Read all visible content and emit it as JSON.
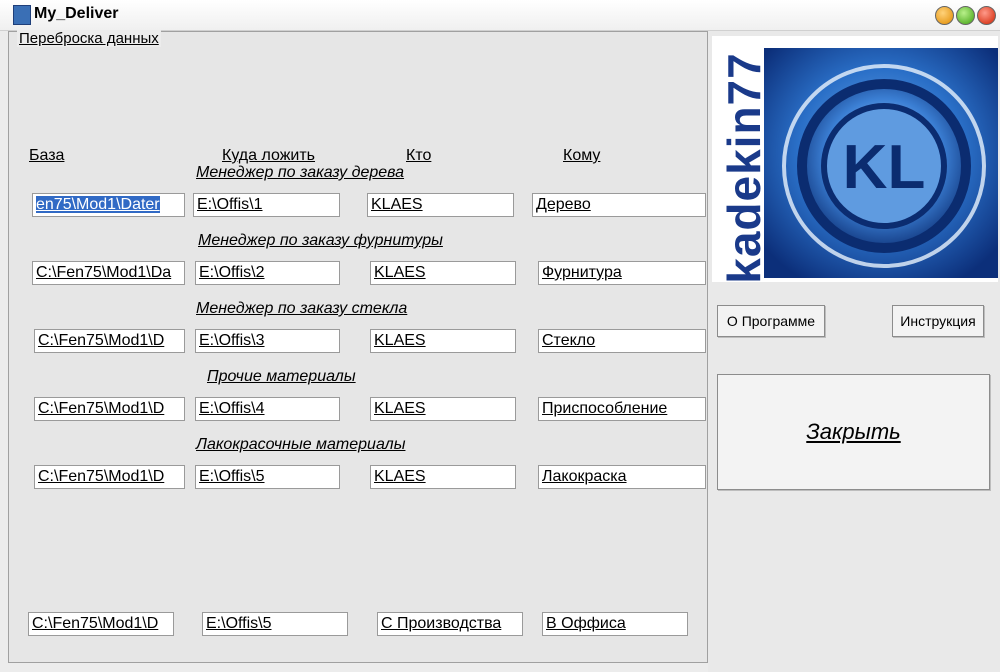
{
  "window": {
    "title": "My_Deliver"
  },
  "group": {
    "legend": "Переброска данных"
  },
  "headers": {
    "base": "База",
    "dest": "Куда ложить",
    "who": "Кто",
    "whom": "Кому"
  },
  "rows": [
    {
      "caption": "Менеджер по заказу дерева",
      "base": "en75\\Mod1\\Dater",
      "dest": "E:\\Offis\\1",
      "who": "KLAES",
      "whom": "Дерево"
    },
    {
      "caption": "Менеджер по заказу фурнитуры",
      "base": "C:\\Fen75\\Mod1\\Da",
      "dest": "E:\\Offis\\2",
      "who": "KLAES",
      "whom": "Фурнитура"
    },
    {
      "caption": "Менеджер по заказу стекла",
      "base": "C:\\Fen75\\Mod1\\D",
      "dest": "E:\\Offis\\3",
      "who": "KLAES",
      "whom": "Стекло"
    },
    {
      "caption": "Прочие материалы",
      "base": "C:\\Fen75\\Mod1\\D",
      "dest": "E:\\Offis\\4",
      "who": "KLAES",
      "whom": "Приспособление"
    },
    {
      "caption": "Лакокрасочные материалы",
      "base": "C:\\Fen75\\Mod1\\D",
      "dest": "E:\\Offis\\5",
      "who": "KLAES",
      "whom": "Лакокраска"
    }
  ],
  "bottom": {
    "base": "C:\\Fen75\\Mod1\\D",
    "dest": "E:\\Offis\\5",
    "who": "С Производства",
    "whom": "В Оффиса"
  },
  "logo": {
    "text": "kadekin77",
    "emblem": "KL"
  },
  "buttons": {
    "about": "О Программе",
    "help": "Инструкция",
    "close": "Закрыть"
  },
  "colors": {
    "selection": "#316ac5",
    "logo_blue": "#1a3a8a"
  }
}
